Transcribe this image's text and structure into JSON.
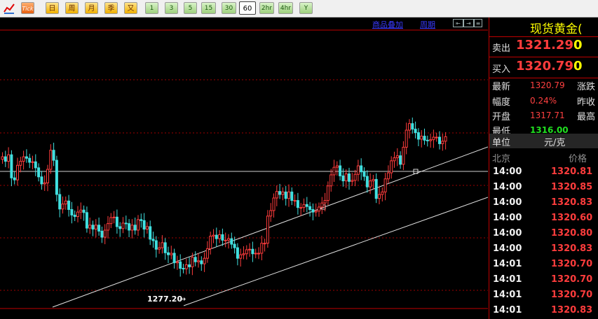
{
  "toolbar": {
    "buttons": [
      {
        "label": "Tick",
        "kind": "tick"
      },
      {
        "label": "日",
        "kind": "cn"
      },
      {
        "label": "周",
        "kind": "cn"
      },
      {
        "label": "月",
        "kind": "cn"
      },
      {
        "label": "季",
        "kind": "cn"
      },
      {
        "label": "又",
        "kind": "cn"
      },
      {
        "label": "1",
        "kind": "num"
      },
      {
        "label": "3",
        "kind": "num"
      },
      {
        "label": "5",
        "kind": "num"
      },
      {
        "label": "15",
        "kind": "num"
      },
      {
        "label": "30",
        "kind": "num"
      },
      {
        "label": "60",
        "kind": "sel"
      },
      {
        "label": "2hr",
        "kind": "num"
      },
      {
        "label": "4hr",
        "kind": "num"
      },
      {
        "label": "Y",
        "kind": "num"
      }
    ]
  },
  "chart_links": {
    "overlay": "商品叠加",
    "period": "周期"
  },
  "chart_annotation": {
    "low_label": "1277.20"
  },
  "chart_data": {
    "type": "candlestick",
    "series": [
      {
        "name": "",
        "values": [
          1299.5,
          1298.6,
          1299.9,
          1295.3,
          1294.9,
          1297.8,
          1298.6,
          1299.5,
          1299.2,
          1298.4,
          1298.5,
          1297.3,
          1295.5,
          1294.1,
          1294.3,
          1297.0,
          1300.8,
          1298.8,
          1292.0,
          1289.1,
          1290.1,
          1290.7,
          1289.0,
          1287.9,
          1287.6,
          1288.5,
          1288.9,
          1288.4,
          1285.3,
          1285.9,
          1285.1,
          1285.9,
          1284.7,
          1283.5,
          1284.9,
          1286.2,
          1287.4,
          1287.5,
          1285.6,
          1285.2,
          1286.3,
          1286.2,
          1284.9,
          1285.9,
          1284.9,
          1287.0,
          1286.8,
          1285.1,
          1285.6,
          1283.1,
          1282.8,
          1281.1,
          1281.4,
          1282.4,
          1280.4,
          1280.0,
          1280.3,
          1278.4,
          1278.6,
          1277.3,
          1277.2,
          1278.0,
          1277.6,
          1279.5,
          1278.6,
          1278.8,
          1278.2,
          1279.3,
          1281.2,
          1283.7,
          1283.9,
          1283.2,
          1284.0,
          1282.9,
          1282.9,
          1283.2,
          1282.1,
          1281.4,
          1279.3,
          1280.0,
          1280.2,
          1281.0,
          1281.1,
          1280.2,
          1280.3,
          1280.3,
          1282.3,
          1282.3,
          1287.7,
          1288.8,
          1291.3,
          1292.6,
          1292.0,
          1292.5,
          1291.2,
          1292.5,
          1290.8,
          1290.8,
          1289.4,
          1289.4,
          1290.0,
          1289.6,
          1289.0,
          1288.5,
          1288.7,
          1289.5,
          1290.3,
          1290.8,
          1293.7,
          1295.9,
          1297.4,
          1297.7,
          1295.7,
          1294.7,
          1296.1,
          1294.6,
          1294.8,
          1296.0,
          1297.7,
          1296.5,
          1295.6,
          1293.5,
          1294.7,
          1295.0,
          1291.2,
          1292.0,
          1292.5,
          1295.1,
          1296.3,
          1298.7,
          1299.3,
          1299.7,
          1298.0,
          1301.4,
          1304.8,
          1306.1,
          1305.0,
          1304.3,
          1303.0,
          1303.6,
          1302.8,
          1302.7,
          1302.9,
          1303.4,
          1303.4,
          1302.1,
          1302.6,
          1303.5
        ]
      }
    ]
  },
  "panel": {
    "title": "现货黄金(",
    "sell_label": "卖出",
    "sell_price": "1321.29",
    "sell_vol": "0",
    "buy_label": "买入",
    "buy_price": "1320.79",
    "buy_vol": "0",
    "stats": [
      {
        "label": "最新",
        "value": "1320.79",
        "color": "#ff4040",
        "label2": "涨跌"
      },
      {
        "label": "幅度",
        "value": "0.24%",
        "color": "#ff4040",
        "label2": "昨收"
      },
      {
        "label": "开盘",
        "value": "1317.71",
        "color": "#ff4040",
        "label2": "最高"
      },
      {
        "label": "最低",
        "value": "1316.00",
        "color": "#20e020",
        "label2": ""
      }
    ],
    "unit_label": "单位",
    "unit_value": "元/克",
    "col_time": "北京",
    "col_price": "价格",
    "ticks": [
      {
        "time": "14:00",
        "price": "1320.81"
      },
      {
        "time": "14:00",
        "price": "1320.85"
      },
      {
        "time": "14:00",
        "price": "1320.83"
      },
      {
        "time": "14:00",
        "price": "1320.60"
      },
      {
        "time": "14:00",
        "price": "1320.80"
      },
      {
        "time": "14:00",
        "price": "1320.83"
      },
      {
        "time": "14:01",
        "price": "1320.70"
      },
      {
        "time": "14:01",
        "price": "1320.70"
      },
      {
        "time": "14:01",
        "price": "1320.70"
      },
      {
        "time": "14:01",
        "price": "1320.83"
      }
    ]
  }
}
